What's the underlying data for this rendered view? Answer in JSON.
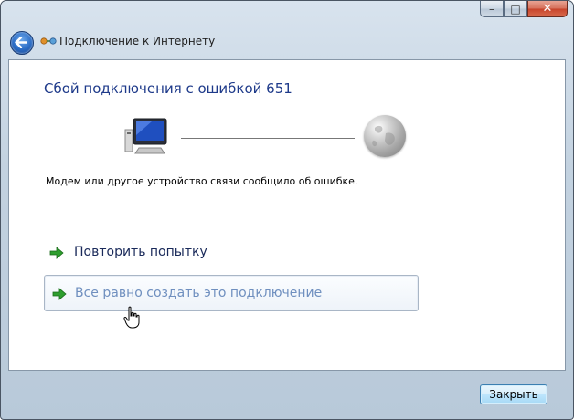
{
  "window": {
    "title": "Подключение к Интернету",
    "caption_buttons": {
      "minimize": "–",
      "maximize": "□",
      "close": "✕"
    }
  },
  "main": {
    "heading": "Сбой подключения с ошибкой 651",
    "message": "Модем или другое устройство связи сообщило об ошибке.",
    "options": [
      {
        "label": "Повторить попытку",
        "icon": "green-arrow-icon"
      },
      {
        "label": "Все равно создать это подключение",
        "icon": "green-arrow-icon"
      }
    ],
    "icons": {
      "computer": "computer-icon",
      "globe": "globe-icon"
    }
  },
  "footer": {
    "close_label": "Закрыть"
  },
  "colors": {
    "heading": "#1e3a8a",
    "link_hover": "#6f8fbf",
    "accent_arrow": "#2e9e2e"
  }
}
